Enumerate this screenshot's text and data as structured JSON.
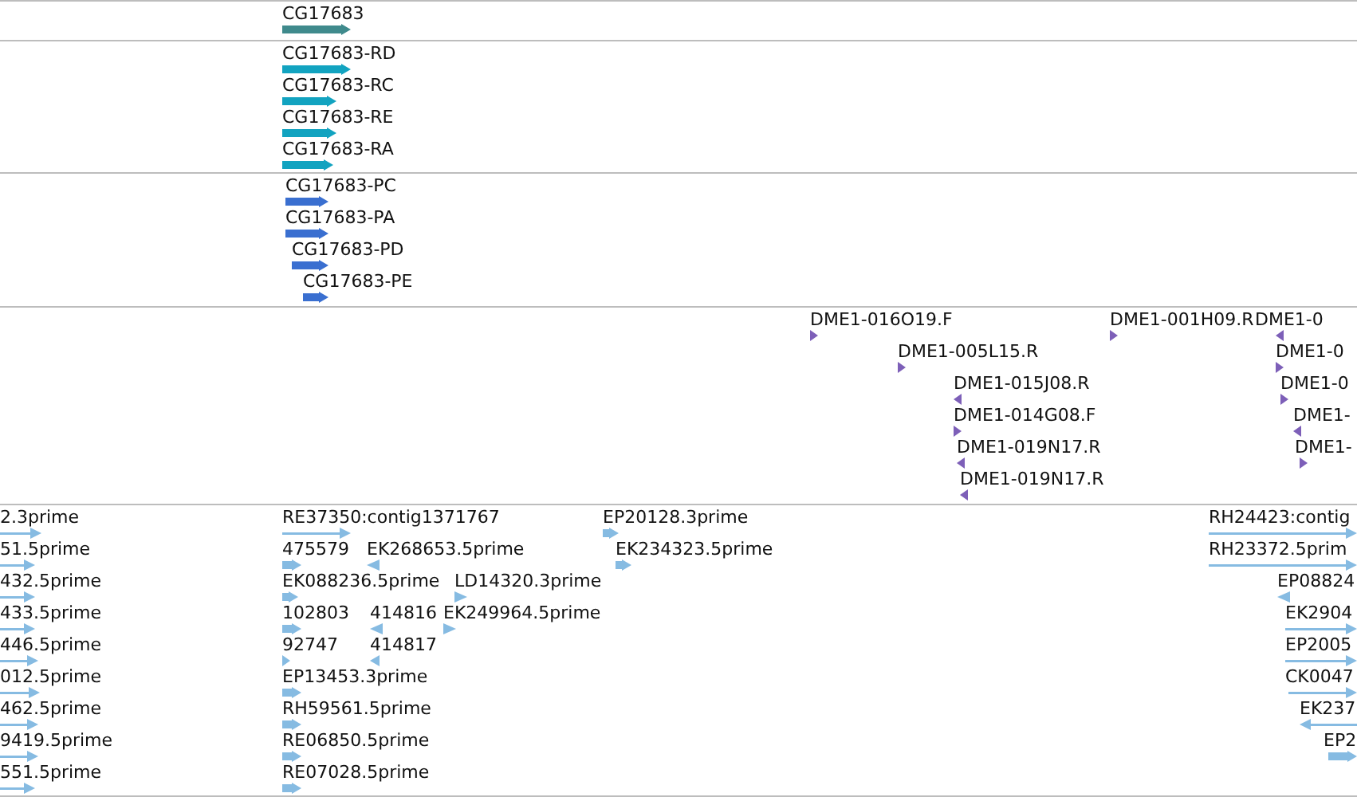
{
  "tracks": [
    {
      "kind": "gene",
      "features": [
        {
          "label": "CG17683",
          "reverse": false
        }
      ]
    },
    {
      "kind": "transcript",
      "features": [
        {
          "label": "CG17683-RD",
          "reverse": false
        },
        {
          "label": "CG17683-RC",
          "reverse": false
        },
        {
          "label": "CG17683-RE",
          "reverse": false
        },
        {
          "label": "CG17683-RA",
          "reverse": false
        }
      ]
    },
    {
      "kind": "protein",
      "features": [
        {
          "label": "CG17683-PC",
          "reverse": false
        },
        {
          "label": "CG17683-PA",
          "reverse": false
        },
        {
          "label": "CG17683-PD",
          "reverse": false
        },
        {
          "label": "CG17683-PE",
          "reverse": false
        }
      ]
    },
    {
      "kind": "bac_end",
      "features": [
        {
          "label": "DME1-016O19.F",
          "reverse": false
        },
        {
          "label": "DME1-005L15.R",
          "reverse": false
        },
        {
          "label": "DME1-015J08.R",
          "reverse": true
        },
        {
          "label": "DME1-014G08.F",
          "reverse": false
        },
        {
          "label": "DME1-019N17.R",
          "reverse": true
        },
        {
          "label": "DME1-019N17.R",
          "reverse": true
        },
        {
          "label": "DME1-001H09.R",
          "reverse": false
        },
        {
          "label": "DME1-0",
          "reverse": true
        },
        {
          "label": "DME1-0",
          "reverse": false
        },
        {
          "label": "DME1-0",
          "reverse": false
        },
        {
          "label": "DME1-",
          "reverse": true
        },
        {
          "label": "DME1-",
          "reverse": false
        }
      ]
    },
    {
      "kind": "est",
      "features": [
        {
          "label": "2.3prime",
          "reverse": false
        },
        {
          "label": "51.5prime",
          "reverse": false
        },
        {
          "label": "432.5prime",
          "reverse": false
        },
        {
          "label": "433.5prime",
          "reverse": false
        },
        {
          "label": "446.5prime",
          "reverse": false
        },
        {
          "label": "012.5prime",
          "reverse": false
        },
        {
          "label": "462.5prime",
          "reverse": false
        },
        {
          "label": "9419.5prime",
          "reverse": false
        },
        {
          "label": "551.5prime",
          "reverse": false
        },
        {
          "label": "RE37350:contig1371767",
          "reverse": false
        },
        {
          "label": "475579",
          "reverse": false
        },
        {
          "label": "EK268653.5prime",
          "reverse": true
        },
        {
          "label": "EK088236.5prime",
          "reverse": false
        },
        {
          "label": "LD14320.3prime",
          "reverse": false
        },
        {
          "label": "102803",
          "reverse": false
        },
        {
          "label": "414816",
          "reverse": true
        },
        {
          "label": "EK249964.5prime",
          "reverse": false
        },
        {
          "label": "92747",
          "reverse": false
        },
        {
          "label": "414817",
          "reverse": true
        },
        {
          "label": "EP13453.3prime",
          "reverse": false
        },
        {
          "label": "RH59561.5prime",
          "reverse": false
        },
        {
          "label": "RE06850.5prime",
          "reverse": false
        },
        {
          "label": "RE07028.5prime",
          "reverse": false
        },
        {
          "label": "EP20128.3prime",
          "reverse": false
        },
        {
          "label": "EK234323.5prime",
          "reverse": false
        },
        {
          "label": "RH24423:contig",
          "reverse": false
        },
        {
          "label": "RH23372.5prim",
          "reverse": false
        },
        {
          "label": "EP08824",
          "reverse": true
        },
        {
          "label": "EK2904",
          "reverse": false
        },
        {
          "label": "EP2005",
          "reverse": false
        },
        {
          "label": "CK0047",
          "reverse": false
        },
        {
          "label": "EK237",
          "reverse": true
        },
        {
          "label": "EP2",
          "reverse": false
        }
      ]
    }
  ]
}
